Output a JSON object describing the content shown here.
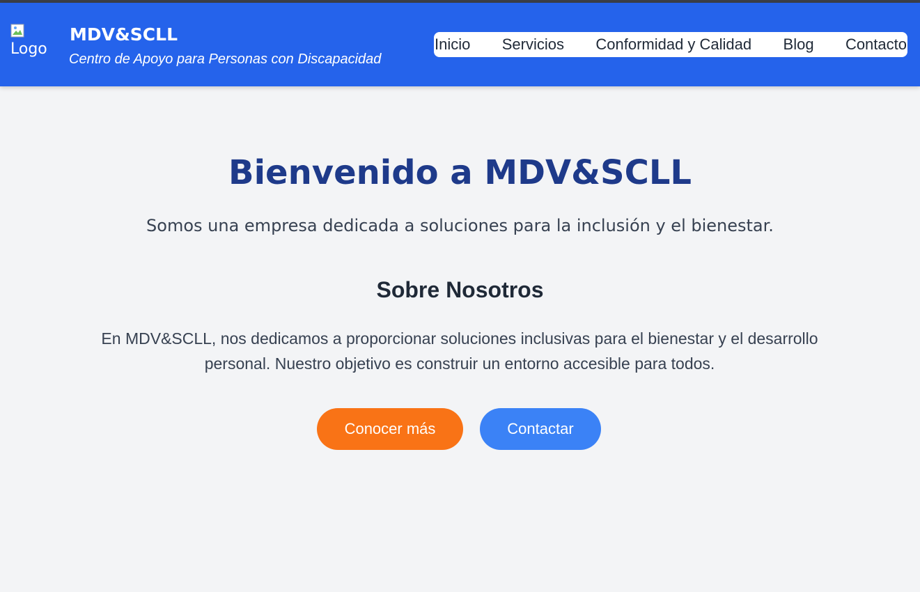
{
  "header": {
    "logo_alt": "Logo",
    "brand_title": "MDV&SCLL",
    "brand_subtitle": "Centro de Apoyo para Personas con Discapacidad",
    "nav": [
      {
        "label": "Inicio"
      },
      {
        "label": "Servicios"
      },
      {
        "label": "Conformidad y Calidad"
      },
      {
        "label": "Blog"
      },
      {
        "label": "Contacto"
      }
    ]
  },
  "hero": {
    "title": "Bienvenido a MDV&SCLL",
    "subtitle": "Somos una empresa dedicada a soluciones para la inclusión y el bienestar."
  },
  "about": {
    "heading": "Sobre Nosotros",
    "text": "En MDV&SCLL, nos dedicamos a proporcionar soluciones inclusivas para el bienestar y el desarrollo personal. Nuestro objetivo es construir un entorno accesible para todos."
  },
  "actions": {
    "primary_label": "Conocer más",
    "secondary_label": "Contactar"
  },
  "colors": {
    "header_bg": "#2563eb",
    "page_bg": "#f3f4f6",
    "title": "#1e3a8a",
    "primary_button": "#f97316",
    "secondary_button": "#3b82f6"
  },
  "icons": {
    "logo": "broken-image-icon"
  }
}
